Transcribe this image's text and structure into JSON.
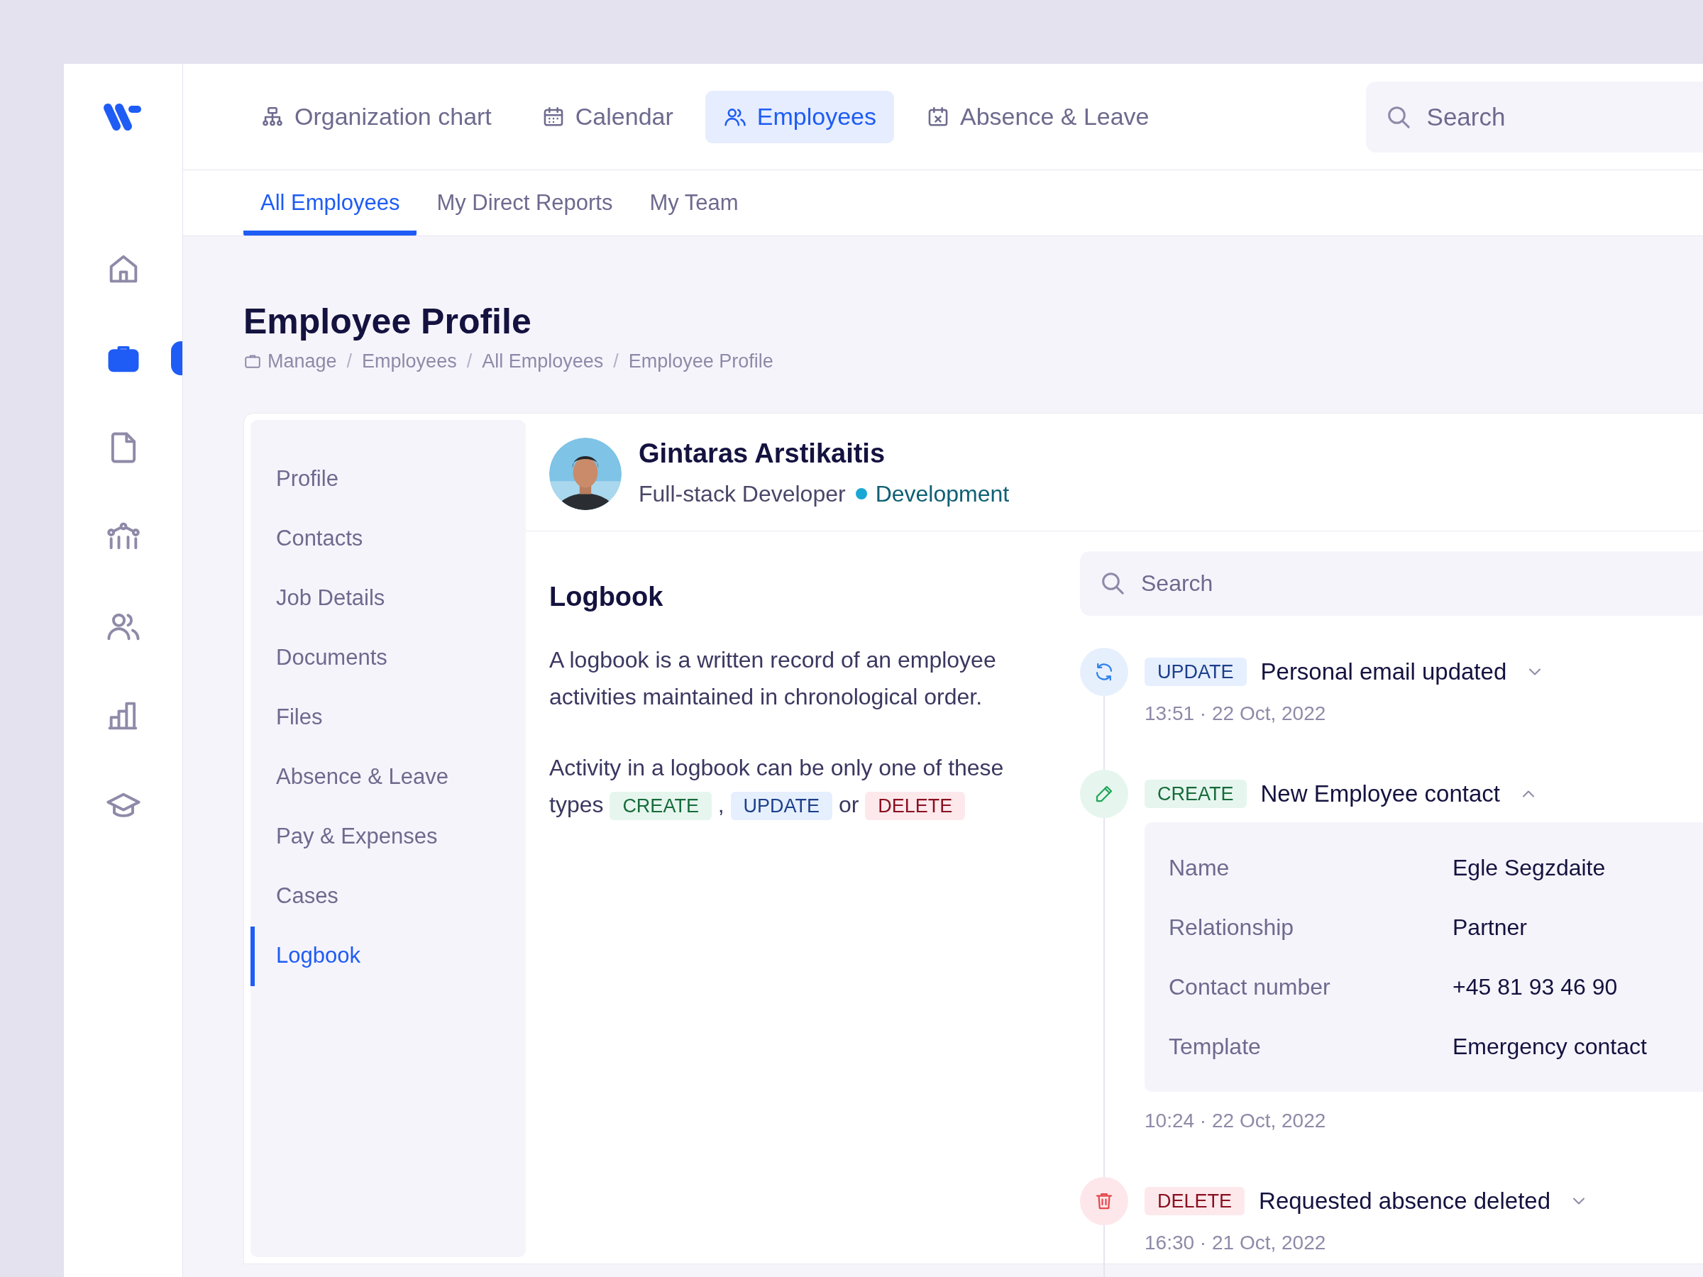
{
  "rail_items": [
    {
      "kind": "home",
      "selected": false
    },
    {
      "kind": "briefcase",
      "selected": true
    },
    {
      "kind": "document",
      "selected": false
    },
    {
      "kind": "nodes",
      "selected": false
    },
    {
      "kind": "users",
      "selected": false
    },
    {
      "kind": "bars",
      "selected": false
    },
    {
      "kind": "graduation",
      "selected": false
    }
  ],
  "nav_tabs": [
    {
      "kind": "org",
      "label": "Organization chart",
      "selected": false
    },
    {
      "kind": "calendar",
      "label": "Calendar",
      "selected": false
    },
    {
      "kind": "users",
      "label": "Employees",
      "selected": true
    },
    {
      "kind": "absence",
      "label": "Absence & Leave",
      "selected": false
    }
  ],
  "top_search": {
    "placeholder": "Search"
  },
  "sub_tabs": [
    {
      "label": "All Employees",
      "selected": true
    },
    {
      "label": "My Direct Reports",
      "selected": false
    },
    {
      "label": "My Team",
      "selected": false
    }
  ],
  "page_title": "Employee Profile",
  "breadcrumb": [
    "Manage",
    "Employees",
    "All Employees",
    "Employee Profile"
  ],
  "breadcrumb_separator": "/",
  "profile_menu": [
    {
      "label": "Profile",
      "selected": false
    },
    {
      "label": "Contacts",
      "selected": false
    },
    {
      "label": "Job Details",
      "selected": false
    },
    {
      "label": "Documents",
      "selected": false
    },
    {
      "label": "Files",
      "selected": false
    },
    {
      "label": "Absence & Leave",
      "selected": false
    },
    {
      "label": "Pay & Expenses",
      "selected": false
    },
    {
      "label": "Cases",
      "selected": false
    },
    {
      "label": "Logbook",
      "selected": true
    }
  ],
  "employee": {
    "name": "Gintaras Arstikaitis",
    "role": "Full-stack Developer",
    "department": "Development"
  },
  "logbook": {
    "title": "Logbook",
    "description": "A logbook is a written record of an employee activities maintained in chronological order.",
    "types_text": "Activity in a logbook can be only one of these",
    "types_lead": "types",
    "types": [
      {
        "kind": "create",
        "label": "CREATE"
      },
      {
        "kind": "update",
        "label": "UPDATE"
      },
      {
        "kind": "delete",
        "label": "DELETE"
      }
    ],
    "joiners": [
      ",",
      "or"
    ]
  },
  "log_search": {
    "placeholder": "Search"
  },
  "entries": [
    {
      "kind": "update",
      "badge": "UPDATE",
      "title": "Personal email updated",
      "time": "13:51 · 22 Oct, 2022",
      "expanded": false
    },
    {
      "kind": "create",
      "badge": "CREATE",
      "title": "New Employee contact",
      "time": "10:24 · 22 Oct, 2022",
      "expanded": true,
      "details": [
        {
          "label": "Name",
          "value": "Egle Segzdaite"
        },
        {
          "label": "Relationship",
          "value": "Partner"
        },
        {
          "label": "Contact number",
          "value": "+45 81 93 46 90"
        },
        {
          "label": "Template",
          "value": "Emergency contact"
        }
      ]
    },
    {
      "kind": "delete",
      "badge": "DELETE",
      "title": "Requested absence deleted",
      "time": "16:30 · 21 Oct, 2022",
      "expanded": false
    }
  ]
}
